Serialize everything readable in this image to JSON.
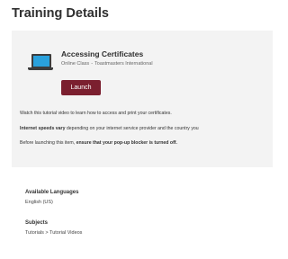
{
  "page": {
    "title": "Training Details"
  },
  "course": {
    "icon": "laptop-icon",
    "title": "Accessing Certificates",
    "type": "Online Class",
    "separator": "-",
    "provider": "Toastmasters International",
    "launch_label": "Launch",
    "launch_color": "#7b1f2f"
  },
  "info": {
    "line1": "Watch this tutorial video to learn how to access and print your certificates.",
    "line2_bold": "Internet speeds vary",
    "line2_rest": " depending on your internet service provider and the country you",
    "line3_start": "Before launching this item, ",
    "line3_bold": "ensure that your pop-up blocker is turned off."
  },
  "details": {
    "languages_label": "Available Languages",
    "languages_value": "English (US)",
    "subjects_label": "Subjects",
    "subjects_value": "Tutorials > Tutorial Videos"
  }
}
